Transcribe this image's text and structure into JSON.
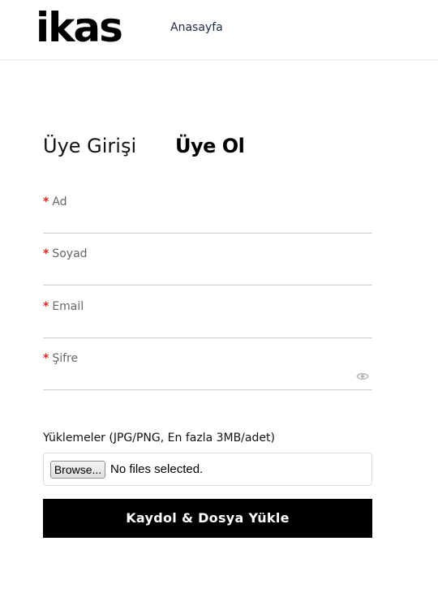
{
  "header": {
    "logo_text": "ikas",
    "nav": [
      {
        "label": "Anasayfa"
      }
    ]
  },
  "tabs": {
    "login_label": "Üye Girişi",
    "register_label": "Üye Ol",
    "active": "register"
  },
  "form": {
    "required_marker": "*",
    "fields": [
      {
        "label": "Ad",
        "value": "",
        "required": true
      },
      {
        "label": "Soyad",
        "value": "",
        "required": true
      },
      {
        "label": "Email",
        "value": "",
        "required": true
      },
      {
        "label": "Şifre",
        "value": "",
        "required": true,
        "icon": "eye-icon"
      }
    ],
    "uploads_label": "Yüklemeler (JPG/PNG, En fazla 3MB/adet)",
    "file_input": {
      "button_label": "Browse...",
      "status_text": "No files selected."
    },
    "submit_label": "Kaydol & Dosya Yükle"
  },
  "colors": {
    "required": "#e02424",
    "primary_button_bg": "#000000",
    "primary_button_text": "#ffffff",
    "nav_text": "#1d2b45"
  }
}
